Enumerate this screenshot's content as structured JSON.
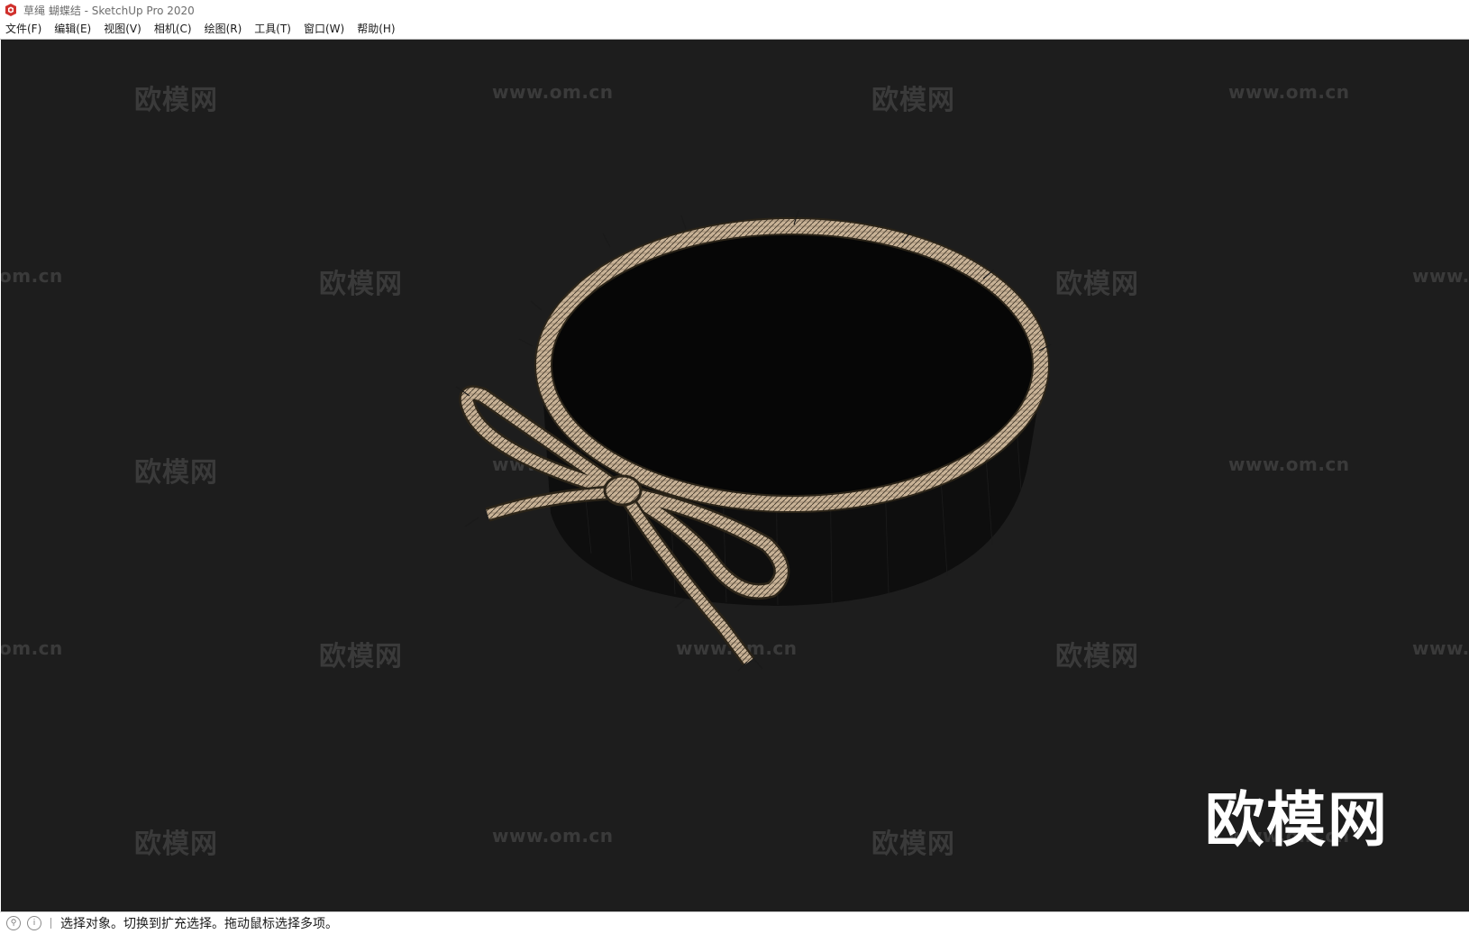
{
  "window": {
    "title": "草绳 蝴蝶结 - SketchUp Pro 2020"
  },
  "menu": {
    "items": [
      {
        "label": "文件(F)"
      },
      {
        "label": "编辑(E)"
      },
      {
        "label": "视图(V)"
      },
      {
        "label": "相机(C)"
      },
      {
        "label": "绘图(R)"
      },
      {
        "label": "工具(T)"
      },
      {
        "label": "窗口(W)"
      },
      {
        "label": "帮助(H)"
      }
    ]
  },
  "viewport": {
    "background_color": "#1d1d1d",
    "rope_color": "#c8b296",
    "watermark_cn": "欧模网",
    "watermark_url": "www.om.cn",
    "watermark_url_partial_left": "om.cn",
    "watermark_url_partial_right": "www.",
    "logo_text": "欧模网"
  },
  "statusbar": {
    "left_icon": "geo-location-icon",
    "info_icon": "info-icon",
    "message": "选择对象。切换到扩充选择。拖动鼠标选择多项。"
  }
}
